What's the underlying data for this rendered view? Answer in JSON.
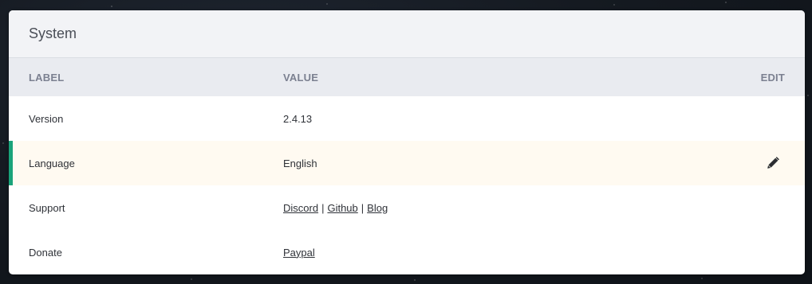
{
  "panel": {
    "title": "System"
  },
  "table": {
    "headers": {
      "label": "LABEL",
      "value": "VALUE",
      "edit": "EDIT"
    },
    "rows": [
      {
        "label": "Version",
        "value": "2.4.13"
      },
      {
        "label": "Language",
        "value": "English",
        "editable": true,
        "edit_icon": "pencil-icon"
      },
      {
        "label": "Support",
        "links": [
          "Discord",
          "Github",
          "Blog"
        ],
        "separator": "|"
      },
      {
        "label": "Donate",
        "links": [
          "Paypal"
        ]
      }
    ]
  },
  "colors": {
    "accent": "#1aa37a",
    "active_row_bg": "#fffaf1",
    "header_bg": "#f2f3f6",
    "table_head_bg": "#e9ebf0"
  }
}
